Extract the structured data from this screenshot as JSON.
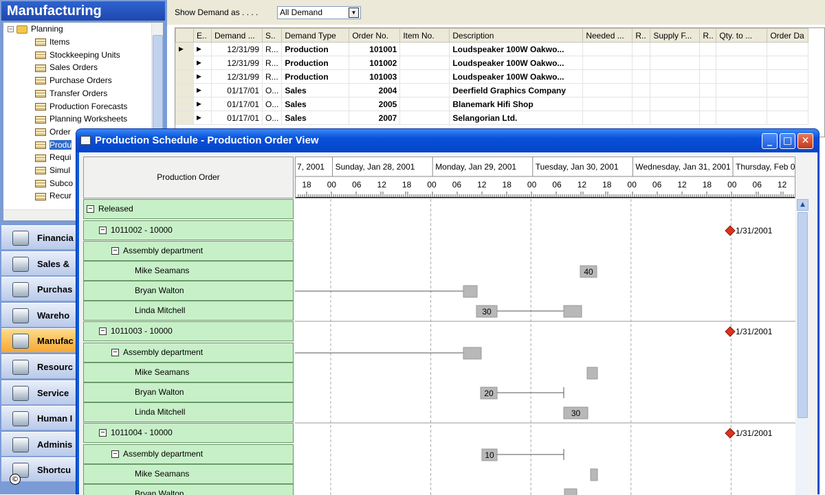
{
  "app": {
    "section_title": "Manufacturing"
  },
  "tree": {
    "root": "Planning",
    "items": [
      "Items",
      "Stockkeeping Units",
      "Sales Orders",
      "Purchase Orders",
      "Transfer Orders",
      "Production Forecasts",
      "Planning Worksheets",
      "Order",
      "Produ",
      "Requi",
      "Simul",
      "Subco",
      "Recur"
    ],
    "selected_index": 8
  },
  "nav_buttons": [
    {
      "label": "Financia",
      "active": false
    },
    {
      "label": "Sales &",
      "active": false
    },
    {
      "label": "Purchas",
      "active": false
    },
    {
      "label": "Wareho",
      "active": false
    },
    {
      "label": "Manufac",
      "active": true
    },
    {
      "label": "Resourc",
      "active": false
    },
    {
      "label": "Service",
      "active": false
    },
    {
      "label": "Human I",
      "active": false
    },
    {
      "label": "Adminis",
      "active": false
    },
    {
      "label": "Shortcu",
      "active": false
    }
  ],
  "toolbar": {
    "show_demand_label": "Show Demand as   . . . .",
    "show_demand_value": "All Demand"
  },
  "grid": {
    "columns": [
      "E..",
      "Demand ...",
      "S..",
      "Demand Type",
      "Order No.",
      "Item No.",
      "Description",
      "Needed ...",
      "R..",
      "Supply F...",
      "R..",
      "Qty. to ...",
      "Order Da"
    ],
    "rows": [
      {
        "date": "12/31/99",
        "s": "R...",
        "type": "Production",
        "order": "101001",
        "item": "",
        "desc": "Loudspeaker 100W Oakwo..."
      },
      {
        "date": "12/31/99",
        "s": "R...",
        "type": "Production",
        "order": "101002",
        "item": "",
        "desc": "Loudspeaker 100W Oakwo..."
      },
      {
        "date": "12/31/99",
        "s": "R...",
        "type": "Production",
        "order": "101003",
        "item": "",
        "desc": "Loudspeaker 100W Oakwo..."
      },
      {
        "date": "01/17/01",
        "s": "O...",
        "type": "Sales",
        "order": "2004",
        "item": "",
        "desc": "Deerfield Graphics Company"
      },
      {
        "date": "01/17/01",
        "s": "O...",
        "type": "Sales",
        "order": "2005",
        "item": "",
        "desc": "Blanemark Hifi Shop"
      },
      {
        "date": "01/17/01",
        "s": "O...",
        "type": "Sales",
        "order": "2007",
        "item": "",
        "desc": "Selangorian Ltd."
      }
    ]
  },
  "schedule": {
    "title": "Production Schedule - Production Order View",
    "left_header": "Production Order",
    "days": [
      "7, 2001",
      "Sunday, Jan 28, 2001",
      "Monday, Jan 29, 2001",
      "Tuesday, Jan 30, 2001",
      "Wednesday, Jan 31, 2001",
      "Thursday, Feb 0"
    ],
    "hour_labels": [
      "18",
      "00",
      "06",
      "12",
      "18",
      "00",
      "06",
      "12",
      "18",
      "00",
      "06",
      "12",
      "18",
      "00",
      "06",
      "12",
      "18",
      "00",
      "06",
      "12"
    ],
    "rows": [
      {
        "label": "Released",
        "level": 0,
        "expander": true
      },
      {
        "label": "1011002 - 10000",
        "level": 1,
        "expander": true
      },
      {
        "label": "Assembly department",
        "level": 2,
        "expander": true
      },
      {
        "label": "Mike Seamans",
        "level": 3,
        "expander": false
      },
      {
        "label": "Bryan Walton",
        "level": 3,
        "expander": false
      },
      {
        "label": "Linda Mitchell",
        "level": 3,
        "expander": false
      },
      {
        "label": "1011003 - 10000",
        "level": 1,
        "expander": true
      },
      {
        "label": "Assembly department",
        "level": 2,
        "expander": true
      },
      {
        "label": "Mike Seamans",
        "level": 3,
        "expander": false
      },
      {
        "label": "Bryan Walton",
        "level": 3,
        "expander": false
      },
      {
        "label": "Linda Mitchell",
        "level": 3,
        "expander": false
      },
      {
        "label": "1011004 - 10000",
        "level": 1,
        "expander": true
      },
      {
        "label": "Assembly department",
        "level": 2,
        "expander": true
      },
      {
        "label": "Mike Seamans",
        "level": 3,
        "expander": false
      },
      {
        "label": "Bryan Walton",
        "level": 3,
        "expander": false
      }
    ],
    "milestone_label": "1/31/2001",
    "bar_labels": [
      "40",
      "30",
      "20",
      "30",
      "10"
    ]
  },
  "colors": {
    "accent": "#0a5ad8",
    "row_green": "#c8f0c8",
    "milestone": "#e03020",
    "bar": "#b8b8b8"
  }
}
